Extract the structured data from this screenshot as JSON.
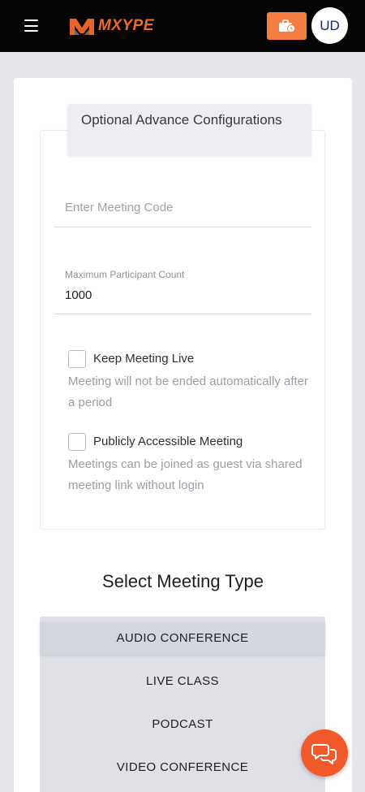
{
  "header": {
    "logo_text": "MXYPE",
    "avatar_initials": "UD",
    "icons": {
      "menu": "hamburger-icon",
      "portfolio": "briefcase-clock-icon"
    },
    "colors": {
      "bar": "#050505",
      "accent": "#f47d42"
    }
  },
  "advanced": {
    "tab_title": "Optional Advance Configurations",
    "meeting_code": {
      "placeholder": "Enter Meeting Code",
      "value": ""
    },
    "max_participants": {
      "label": "Maximum Participant Count",
      "value": "1000"
    },
    "keep_live": {
      "label": "Keep Meeting Live",
      "description": "Meeting will not be ended automatically after a period",
      "checked": false
    },
    "public_access": {
      "label": "Publicly Accessible Meeting",
      "description": "Meetings can be joined as guest via shared meeting link without login",
      "checked": false
    }
  },
  "meeting_type": {
    "title": "Select Meeting Type",
    "options": [
      "AUDIO CONFERENCE",
      "LIVE CLASS",
      "PODCAST",
      "VIDEO CONFERENCE"
    ]
  },
  "chat": {
    "icon": "chat-bubbles-icon",
    "color": "#f35a2b"
  }
}
